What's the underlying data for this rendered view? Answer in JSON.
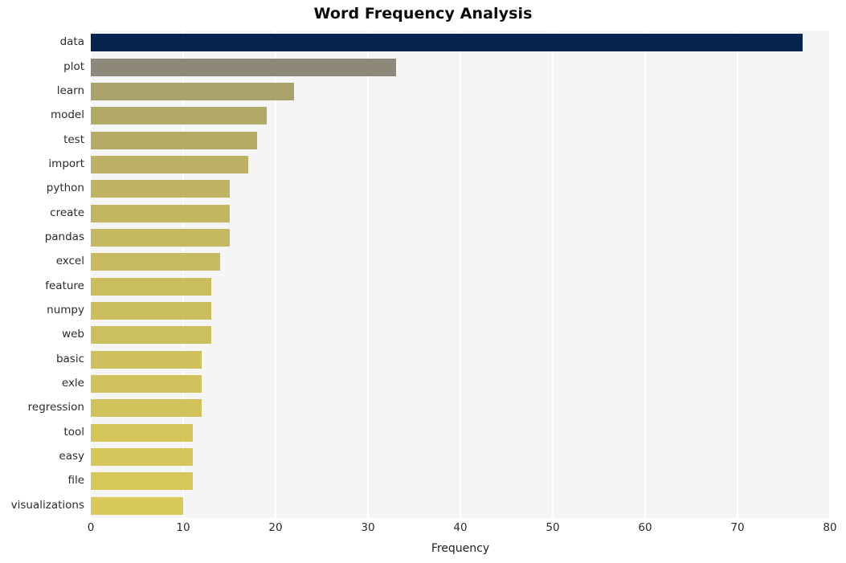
{
  "chart_data": {
    "type": "bar",
    "orientation": "horizontal",
    "title": "Word Frequency Analysis",
    "xlabel": "Frequency",
    "ylabel": "",
    "xlim": [
      0,
      80
    ],
    "xticks": [
      0,
      10,
      20,
      30,
      40,
      50,
      60,
      70,
      80
    ],
    "xtick_labels": [
      "0",
      "10",
      "20",
      "30",
      "40",
      "50",
      "60",
      "70",
      "80"
    ],
    "grid": true,
    "grid_color": "#ffffff",
    "plot_background": "#f5f5f5",
    "figure_background": "#ffffff",
    "legend": null,
    "categories": [
      "data",
      "plot",
      "learn",
      "model",
      "test",
      "import",
      "python",
      "create",
      "pandas",
      "excel",
      "feature",
      "numpy",
      "web",
      "basic",
      "exle",
      "regression",
      "tool",
      "easy",
      "file",
      "visualizations"
    ],
    "values": [
      77,
      33,
      22,
      19,
      18,
      17,
      15,
      15,
      15,
      14,
      13,
      13,
      13,
      12,
      12,
      12,
      11,
      11,
      11,
      10
    ],
    "bar_colors": [
      "#04234f",
      "#8e887b",
      "#aaa16b",
      "#b3a967",
      "#b6ab66",
      "#bcb064",
      "#c0b462",
      "#c2b661",
      "#c4b860",
      "#c7ba5f",
      "#cabd5e",
      "#cbbe5e",
      "#ccbf5d",
      "#cfc15d",
      "#d0c25c",
      "#d1c35c",
      "#d4c55b",
      "#d5c65b",
      "#d6c75b",
      "#d9c95a"
    ]
  }
}
